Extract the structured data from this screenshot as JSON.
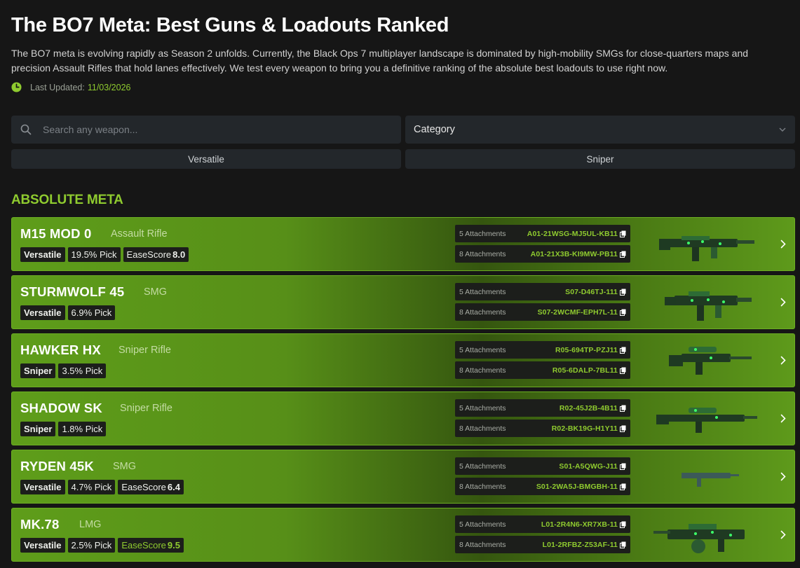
{
  "page": {
    "title": "The BO7 Meta: Best Guns & Loadouts Ranked",
    "intro": "The BO7 meta is evolving rapidly as Season 2 unfolds. Currently, the Black Ops 7 multiplayer landscape is dominated by high-mobility SMGs for close-quarters maps and precision Assault Rifles that hold lanes effectively. We test every weapon to bring you a definitive ranking of the absolute best loadouts to use right now.",
    "updated_label": "Last Updated:",
    "updated_date": "11/03/2026"
  },
  "search": {
    "placeholder": "Search any weapon...",
    "value": ""
  },
  "category": {
    "label": "Category"
  },
  "filters": [
    "Versatile",
    "Sniper"
  ],
  "section": {
    "title": "ABSOLUTE META"
  },
  "colors": {
    "accent": "#8fcb2f",
    "card_green": "#5e9d1a",
    "background": "#161616"
  },
  "weapons": [
    {
      "name": "M15 MOD 0",
      "type": "Assault Rifle",
      "tags": [
        "Versatile",
        "19.5% Pick"
      ],
      "ease_label": "EaseScore",
      "ease_value": "8.0",
      "codes": [
        {
          "attachments": "5 Attachments",
          "code": "A01-21WSG-MJ5UL-KB11"
        },
        {
          "attachments": "8 Attachments",
          "code": "A01-21X3B-KI9MW-PB11"
        }
      ]
    },
    {
      "name": "STURMWOLF 45",
      "type": "SMG",
      "tags": [
        "Versatile",
        "6.9% Pick"
      ],
      "ease_label": "",
      "ease_value": "",
      "codes": [
        {
          "attachments": "5 Attachments",
          "code": "S07-D46TJ-111"
        },
        {
          "attachments": "8 Attachments",
          "code": "S07-2WCMF-EPH7L-11"
        }
      ]
    },
    {
      "name": "HAWKER HX",
      "type": "Sniper Rifle",
      "tags": [
        "Sniper",
        "3.5% Pick"
      ],
      "ease_label": "",
      "ease_value": "",
      "codes": [
        {
          "attachments": "5 Attachments",
          "code": "R05-694TP-PZJ11"
        },
        {
          "attachments": "8 Attachments",
          "code": "R05-6DALP-7BL11"
        }
      ]
    },
    {
      "name": "SHADOW SK",
      "type": "Sniper Rifle",
      "tags": [
        "Sniper",
        "1.8% Pick"
      ],
      "ease_label": "",
      "ease_value": "",
      "codes": [
        {
          "attachments": "5 Attachments",
          "code": "R02-45J2B-4B11"
        },
        {
          "attachments": "8 Attachments",
          "code": "R02-BK19G-H1Y11"
        }
      ]
    },
    {
      "name": "RYDEN 45K",
      "type": "SMG",
      "tags": [
        "Versatile",
        "4.7% Pick"
      ],
      "ease_label": "EaseScore",
      "ease_value": "6.4",
      "codes": [
        {
          "attachments": "5 Attachments",
          "code": "S01-A5QWG-J11"
        },
        {
          "attachments": "8 Attachments",
          "code": "S01-2WA5J-BMGBH-11"
        }
      ]
    },
    {
      "name": "MK.78",
      "type": "LMG",
      "tags": [
        "Versatile",
        "2.5% Pick"
      ],
      "ease_label": "EaseScore",
      "ease_value": "9.5",
      "codes": [
        {
          "attachments": "5 Attachments",
          "code": "L01-2R4N6-XR7XB-11"
        },
        {
          "attachments": "8 Attachments",
          "code": "L01-2RFBZ-Z53AF-11"
        }
      ]
    }
  ]
}
